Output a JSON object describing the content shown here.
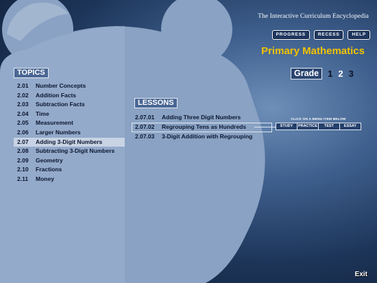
{
  "header": {
    "app_subtitle": "The Interactive Curriculum Encyclopedia",
    "buttons": [
      "PROGRESS",
      "RECESS",
      "HELP"
    ],
    "title": "Primary Mathematics"
  },
  "grade": {
    "label": "Grade",
    "options": [
      "1",
      "2",
      "3"
    ],
    "selected": "2"
  },
  "topics": {
    "heading": "TOPICS",
    "items": [
      {
        "num": "2.01",
        "label": "Number Concepts"
      },
      {
        "num": "2.02",
        "label": "Addition Facts"
      },
      {
        "num": "2.03",
        "label": "Subtraction Facts"
      },
      {
        "num": "2.04",
        "label": "Time"
      },
      {
        "num": "2.05",
        "label": "Measurement"
      },
      {
        "num": "2.06",
        "label": "Larger Numbers"
      },
      {
        "num": "2.07",
        "label": "Adding 3-Digit Numbers"
      },
      {
        "num": "2.08",
        "label": "Subtracting 3-Digit Numbers"
      },
      {
        "num": "2.09",
        "label": "Geometry"
      },
      {
        "num": "2.10",
        "label": "Fractions"
      },
      {
        "num": "2.11",
        "label": "Money"
      }
    ],
    "selected_index": 6
  },
  "lessons": {
    "heading": "LESSONS",
    "items": [
      {
        "num": "2.07.01",
        "label": "Adding Three Digit Numbers"
      },
      {
        "num": "2.07.02",
        "label": "Regrouping Tens as Hundreds"
      },
      {
        "num": "2.07.03",
        "label": "3-Digit Addition with Regrouping"
      }
    ],
    "selected_index": 1
  },
  "lesson_menu": {
    "caption": "CLICK ON A MENU ITEM BELOW",
    "buttons": [
      "STUDY",
      "PRACTICE",
      "TEST",
      "ESSAY"
    ]
  },
  "footer": {
    "exit_label": "Exit"
  },
  "colors": {
    "title": "#f2c200",
    "panel": "#8ea6c6",
    "text_dark": "#0b1730"
  }
}
